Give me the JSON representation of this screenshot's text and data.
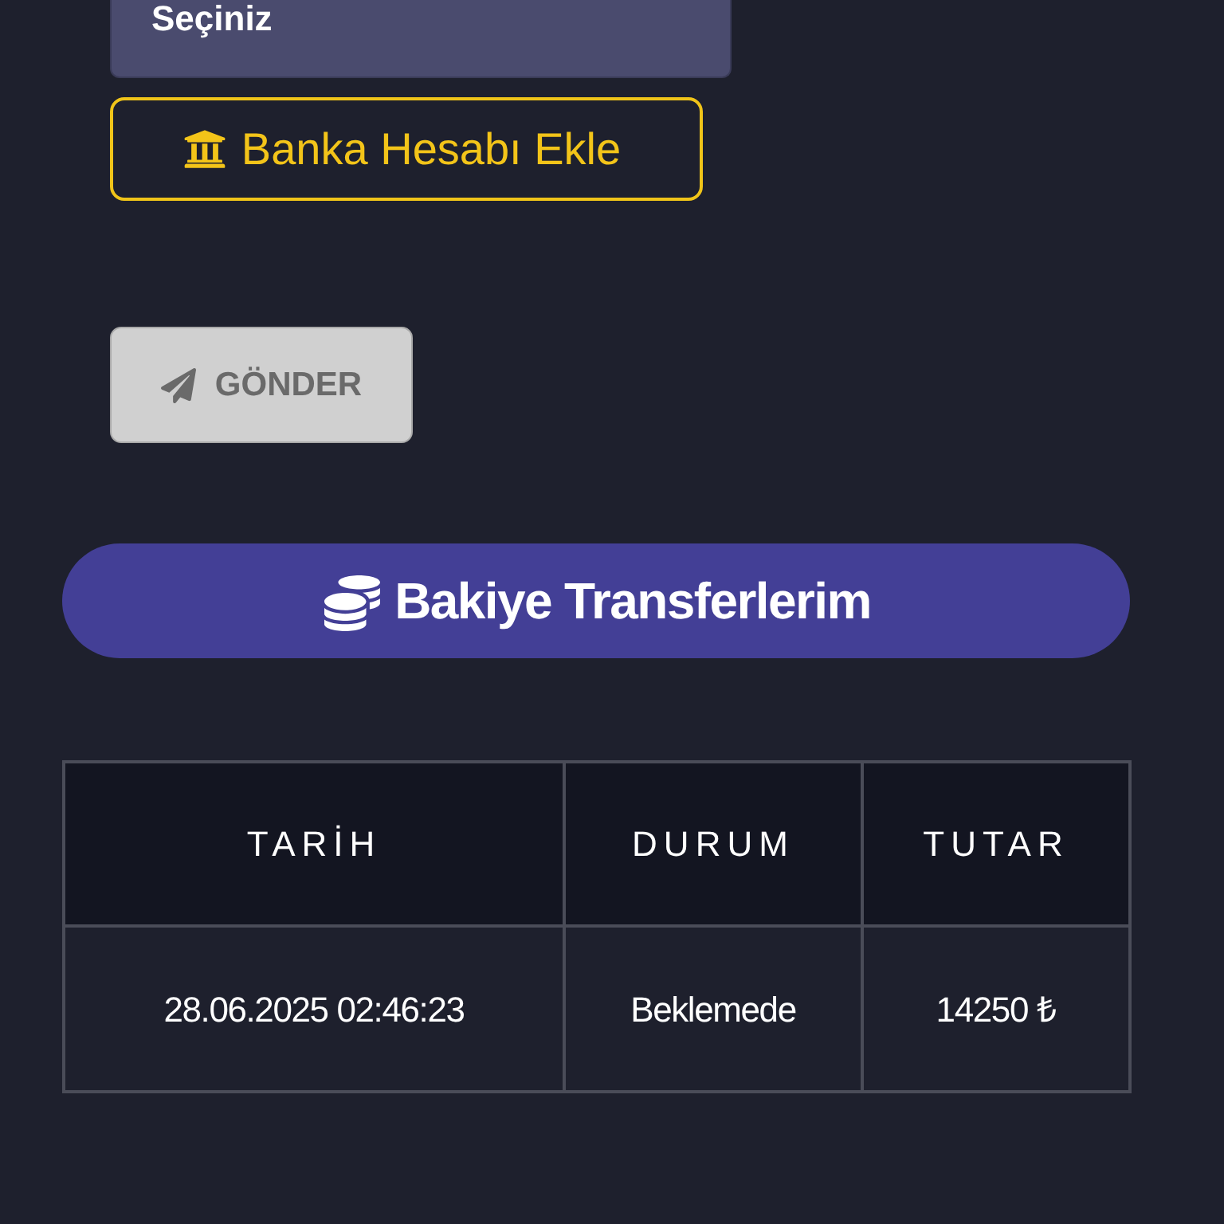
{
  "bank_select": {
    "value": "Seçiniz"
  },
  "add_bank_button": {
    "label": "Banka Hesabı Ekle"
  },
  "send_button": {
    "label": "GÖNDER",
    "disabled": true
  },
  "transfers_header": {
    "title": "Bakiye Transferlerim"
  },
  "transfers_table": {
    "columns": [
      "TARİH",
      "DURUM",
      "TUTAR"
    ],
    "rows": [
      [
        "28.06.2025 02:46:23",
        "Beklemede",
        "14250 ₺"
      ]
    ]
  }
}
